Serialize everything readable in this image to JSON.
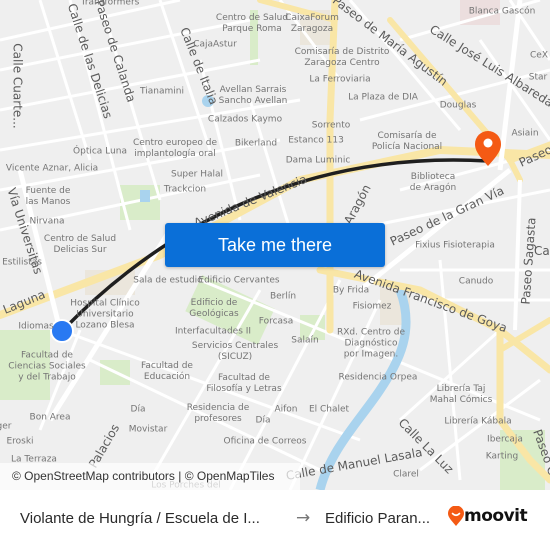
{
  "map": {
    "colors": {
      "background": "#efefef",
      "minor_road": "#ffffff",
      "major_road": "#f9e5a1",
      "park": "#d4ebc2",
      "water": "#a9d3ee",
      "route_line": "#1f1f1f",
      "origin_marker": "#2979f2",
      "destination_marker": "#f45a14"
    },
    "streets": [
      {
        "name": "Calle de las Delicias"
      },
      {
        "name": "Paseo de Calanda"
      },
      {
        "name": "Calle de Italia"
      },
      {
        "name": "Paseo de María Agustín"
      },
      {
        "name": "Calle José Luis Albareda"
      },
      {
        "name": "Avenida de Valencia"
      },
      {
        "name": "Calle ... Aragón"
      },
      {
        "name": "Paseo de la Gran Vía"
      },
      {
        "name": "Avenida Francisco de Goya"
      },
      {
        "name": "Paseo Sagasta"
      },
      {
        "name": "Laguna"
      },
      {
        "name": "Vía Universitas"
      },
      {
        "name": "Calle La Luz"
      },
      {
        "name": "Calle de Manuel Lasala"
      },
      {
        "name": "Palacios"
      },
      {
        "name": "Calle Cuarte..."
      },
      {
        "name": "Paseo"
      },
      {
        "name": "Ca"
      },
      {
        "name": "Paseo Cu..."
      }
    ],
    "pois": [
      {
        "label": "Transformers"
      },
      {
        "label": "Centro de Salud\nParque Roma"
      },
      {
        "label": "CaixaForum\nZaragoza"
      },
      {
        "label": "Blanca Gascón"
      },
      {
        "label": "CajaAstur"
      },
      {
        "label": "Comisaría de Distrito\nZaragoza Centro"
      },
      {
        "label": "La Ferroviaria"
      },
      {
        "label": "CeX"
      },
      {
        "label": "Star"
      },
      {
        "label": "Tianamini"
      },
      {
        "label": "Avellan Sarrais\nSancho Avellan"
      },
      {
        "label": "La Plaza de DIA"
      },
      {
        "label": "Douglas"
      },
      {
        "label": "Calzados Kaymo"
      },
      {
        "label": "Sorrento"
      },
      {
        "label": "Asiain"
      },
      {
        "label": "Centro europeo de\nimplantología oral"
      },
      {
        "label": "Bikerland"
      },
      {
        "label": "Estanco 113"
      },
      {
        "label": "Comisaría de\nPolicía Nacional"
      },
      {
        "label": "Óptica Luna"
      },
      {
        "label": "Dama Luminic"
      },
      {
        "label": "Vicente Aznar, Alicia"
      },
      {
        "label": "Super Halal"
      },
      {
        "label": "Biblioteca\nde Aragón"
      },
      {
        "label": "Fuente de\nlas Manos"
      },
      {
        "label": "Trackcion"
      },
      {
        "label": "Nirvana"
      },
      {
        "label": "Centro de Salud\nDelicias Sur"
      },
      {
        "label": "Fixius Fisioterapia"
      },
      {
        "label": "Estilistas"
      },
      {
        "label": "Canudo"
      },
      {
        "label": "Sala de estudio"
      },
      {
        "label": "Edificio Cervantes"
      },
      {
        "label": "By Frida"
      },
      {
        "label": "Berlín"
      },
      {
        "label": "Fisiomez"
      },
      {
        "label": "Hospital Clínico\nUniversitario\nLozano Blesa"
      },
      {
        "label": "Edificio de\nGeológicas"
      },
      {
        "label": "Idiomas"
      },
      {
        "label": "Forcasa"
      },
      {
        "label": "Interfacultades II"
      },
      {
        "label": "Salaín"
      },
      {
        "label": "RXd. Centro de\nDiagnóstico\npor Imagen."
      },
      {
        "label": "Servicios Centrales\n(SICUZ)"
      },
      {
        "label": "Facultad de\nCiencias Sociales\ny del Trabajo"
      },
      {
        "label": "Facultad de\nEducación"
      },
      {
        "label": "Facultad de\nFilosofía y Letras"
      },
      {
        "label": "Residencia Orpea"
      },
      {
        "label": "Librería Taj\nMahal Cómics"
      },
      {
        "label": "Bon Area"
      },
      {
        "label": "Día"
      },
      {
        "label": "Residencia de\nprofesores"
      },
      {
        "label": "Aifon"
      },
      {
        "label": "El Chalet"
      },
      {
        "label": "Movistar"
      },
      {
        "label": "Día"
      },
      {
        "label": "Librería Kábala"
      },
      {
        "label": "Eroski"
      },
      {
        "label": "Oficina de Correos"
      },
      {
        "label": "Ibercaja"
      },
      {
        "label": "La Terraza"
      },
      {
        "label": "Karting"
      },
      {
        "label": "Clarel"
      },
      {
        "label": "Los Porches del"
      },
      {
        "label": "ger"
      }
    ],
    "markers": {
      "origin": {
        "name": "origin-marker"
      },
      "destination": {
        "name": "destination-marker"
      }
    },
    "cta_button": {
      "label": "Take me there"
    },
    "attribution": "© OpenStreetMap contributors | © OpenMapTiles"
  },
  "footer": {
    "from": "Violante de Hungría / Escuela de I...",
    "arrow": "→",
    "to": "Edificio Paran...",
    "brand": "moovit",
    "brand_color": "#f45a14"
  }
}
